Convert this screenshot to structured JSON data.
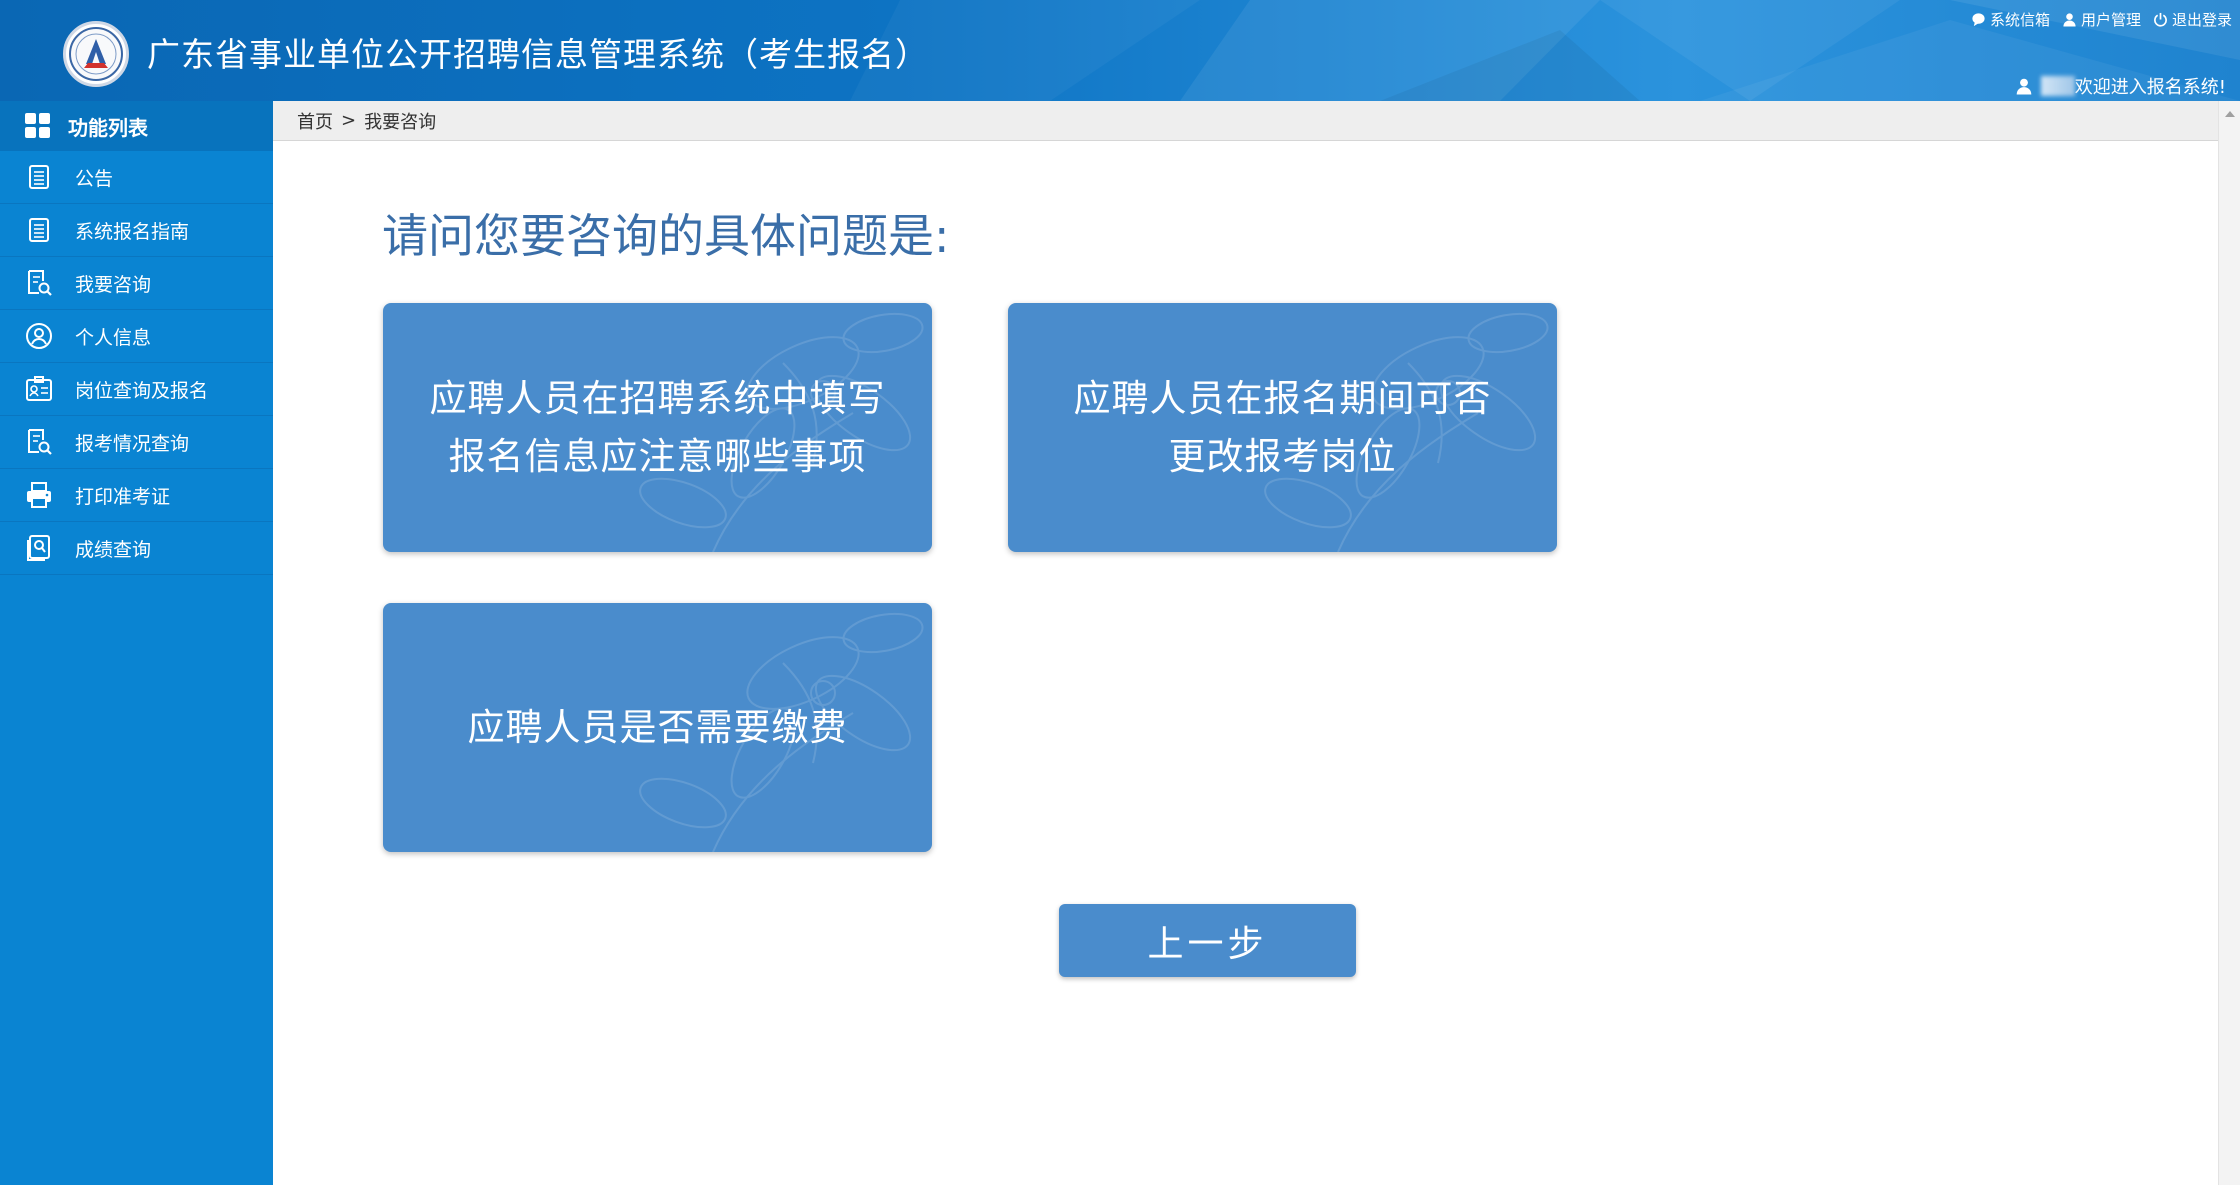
{
  "header": {
    "title": "广东省事业单位公开招聘信息管理系统（考生报名）",
    "links": [
      {
        "label": "系统信箱",
        "icon": "message-icon"
      },
      {
        "label": "用户管理",
        "icon": "user-icon"
      },
      {
        "label": "退出登录",
        "icon": "power-icon"
      }
    ],
    "welcome": "欢迎进入报名系统!"
  },
  "sidebar": {
    "heading": "功能列表",
    "items": [
      {
        "label": "公告",
        "icon": "document-icon"
      },
      {
        "label": "系统报名指南",
        "icon": "document-icon"
      },
      {
        "label": "我要咨询",
        "icon": "search-document-icon"
      },
      {
        "label": "个人信息",
        "icon": "person-circle-icon"
      },
      {
        "label": "岗位查询及报名",
        "icon": "id-card-icon"
      },
      {
        "label": "报考情况查询",
        "icon": "search-document-icon"
      },
      {
        "label": "打印准考证",
        "icon": "printer-icon"
      },
      {
        "label": "成绩查询",
        "icon": "score-icon"
      }
    ]
  },
  "breadcrumb": {
    "home": "首页",
    "separator": ">",
    "current": "我要咨询"
  },
  "main": {
    "question": "请问您要咨询的具体问题是:",
    "cards": [
      {
        "text": "应聘人员在招聘系统中填写\n报名信息应注意哪些事项"
      },
      {
        "text": "应聘人员在报名期间可否\n更改报考岗位"
      },
      {
        "text": "应聘人员是否需要缴费"
      }
    ],
    "back_label": "上一步"
  },
  "colors": {
    "header_blue": "#0d73c3",
    "sidebar_blue": "#0a84d2",
    "card_blue": "#4a8ccc",
    "question_text": "#3a6ea8"
  }
}
